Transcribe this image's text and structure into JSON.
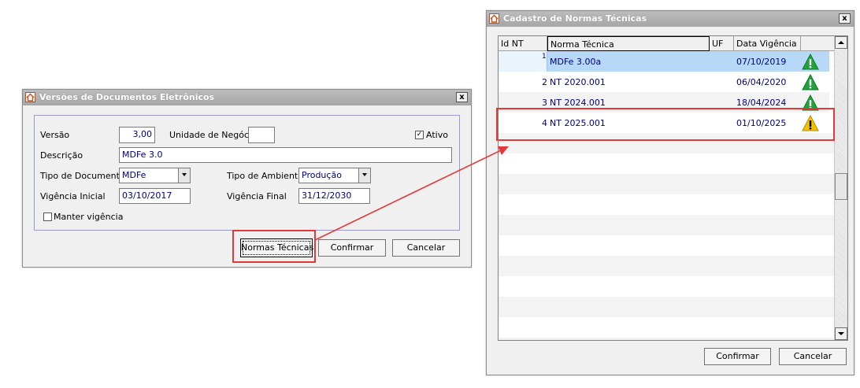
{
  "versoes_dialog": {
    "title": "Versões de Documentos Eletrônicos",
    "close_glyph": "x",
    "labels": {
      "versao": "Versão",
      "unidade_negocio": "Unidade de Negócio",
      "ativo": "Ativo",
      "descricao": "Descrição",
      "tipo_documento": "Tipo de Documento",
      "tipo_ambiente": "Tipo de Ambiente",
      "vigencia_inicial": "Vigência Inicial",
      "vigencia_final": "Vigência Final",
      "manter_vigencia": "Manter vigência"
    },
    "values": {
      "versao": "3,00",
      "unidade_negocio": "",
      "ativo_checked": true,
      "descricao": "MDFe 3.0",
      "tipo_documento": "MDFe",
      "tipo_ambiente": "Produção",
      "vigencia_inicial": "03/10/2017",
      "vigencia_final": "31/12/2030",
      "manter_vigencia_checked": false
    },
    "buttons": {
      "normas_tecnicas": "Normas Técnicas",
      "confirmar": "Confirmar",
      "cancelar": "Cancelar"
    }
  },
  "normas_dialog": {
    "title": "Cadastro de Normas Técnicas",
    "close_glyph": "x",
    "columns": [
      "Id NT",
      "Norma Técnica",
      "UF",
      "Data Vigência"
    ],
    "rows": [
      {
        "id": "1",
        "norma": "MDFe 3.00a",
        "uf": "",
        "data": "07/10/2019",
        "status": "green-warning-icon"
      },
      {
        "id": "2",
        "norma": "NT 2020.001",
        "uf": "",
        "data": "06/04/2020",
        "status": "green-warning-icon"
      },
      {
        "id": "3",
        "norma": "NT 2024.001",
        "uf": "",
        "data": "18/04/2024",
        "status": "green-warning-icon"
      },
      {
        "id": "4",
        "norma": "NT 2025.001",
        "uf": "",
        "data": "01/10/2025",
        "status": "yellow-warning-icon"
      }
    ],
    "buttons": {
      "confirmar": "Confirmar",
      "cancelar": "Cancelar"
    }
  },
  "colors": {
    "highlight_red": "#e23a3a",
    "selected_row": "#b7d8f7",
    "value_text": "#00007a",
    "green_icon": "#1fa33a",
    "yellow_icon": "#f2c200"
  }
}
